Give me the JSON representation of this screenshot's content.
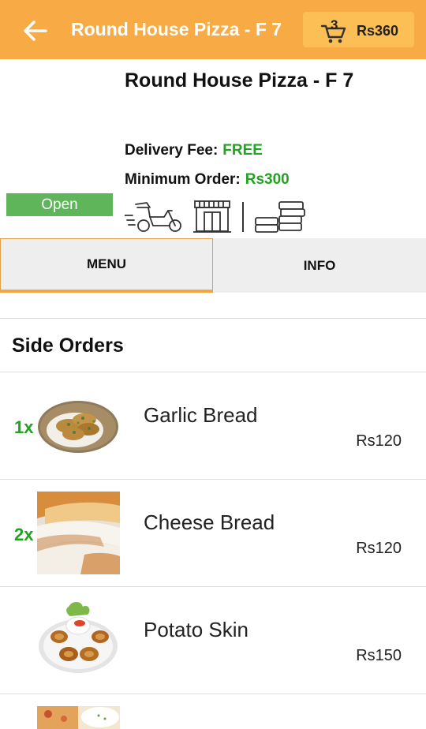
{
  "appbar": {
    "title": "Round House Pizza - F 7",
    "cart_count": "3",
    "cart_total": "Rs360"
  },
  "restaurant": {
    "name": "Round House Pizza - F 7",
    "delivery_fee_label": "Delivery Fee:",
    "delivery_fee_value": "FREE",
    "minimum_order_label": "Minimum Order:",
    "minimum_order_value": "Rs300",
    "status": "Open",
    "service_icons": [
      "delivery-scooter-icon",
      "storefront-icon",
      "stacked-boxes-icon"
    ]
  },
  "tabs": [
    {
      "label": "MENU",
      "active": true
    },
    {
      "label": "INFO",
      "active": false
    }
  ],
  "section": {
    "title": "Side Orders"
  },
  "items": [
    {
      "qty": "1x",
      "name": "Garlic Bread",
      "price": "Rs120",
      "image": "garlic-bread-thumbnail"
    },
    {
      "qty": "2x",
      "name": "Cheese Bread",
      "price": "Rs120",
      "image": "cheese-bread-thumbnail"
    },
    {
      "qty": "",
      "name": "Potato Skin",
      "price": "Rs150",
      "image": "potato-skin-thumbnail"
    }
  ],
  "colors": {
    "appbar": "#f8ab44",
    "cart_button": "#fbbf55",
    "accent_green": "#21a221",
    "open_badge": "#5fb65a",
    "tab_indicator": "#f4a640"
  }
}
